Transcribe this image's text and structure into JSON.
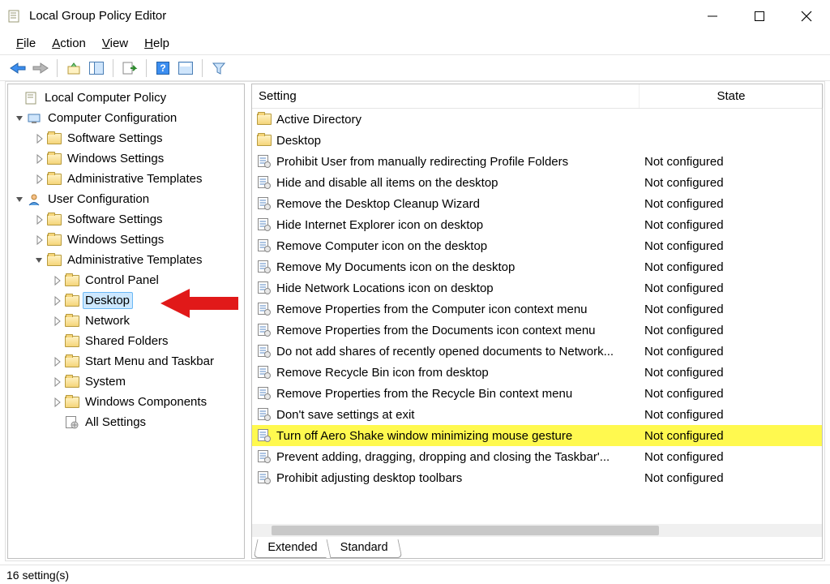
{
  "window": {
    "title": "Local Group Policy Editor"
  },
  "menus": {
    "file": "File",
    "action": "Action",
    "view": "View",
    "help": "Help"
  },
  "tree": {
    "root": "Local Computer Policy",
    "cc": "Computer Configuration",
    "cc_ss": "Software Settings",
    "cc_ws": "Windows Settings",
    "cc_at": "Administrative Templates",
    "uc": "User Configuration",
    "uc_ss": "Software Settings",
    "uc_ws": "Windows Settings",
    "uc_at": "Administrative Templates",
    "uc_at_cp": "Control Panel",
    "uc_at_desktop": "Desktop",
    "uc_at_network": "Network",
    "uc_at_sf": "Shared Folders",
    "uc_at_smt": "Start Menu and Taskbar",
    "uc_at_sys": "System",
    "uc_at_wc": "Windows Components",
    "uc_at_all": "All Settings"
  },
  "list": {
    "col_setting": "Setting",
    "col_state": "State",
    "rows": [
      {
        "type": "folder",
        "name": "Active Directory",
        "state": ""
      },
      {
        "type": "folder",
        "name": "Desktop",
        "state": ""
      },
      {
        "type": "setting",
        "name": "Prohibit User from manually redirecting Profile Folders",
        "state": "Not configured"
      },
      {
        "type": "setting",
        "name": "Hide and disable all items on the desktop",
        "state": "Not configured"
      },
      {
        "type": "setting",
        "name": "Remove the Desktop Cleanup Wizard",
        "state": "Not configured"
      },
      {
        "type": "setting",
        "name": "Hide Internet Explorer icon on desktop",
        "state": "Not configured"
      },
      {
        "type": "setting",
        "name": "Remove Computer icon on the desktop",
        "state": "Not configured"
      },
      {
        "type": "setting",
        "name": "Remove My Documents icon on the desktop",
        "state": "Not configured"
      },
      {
        "type": "setting",
        "name": "Hide Network Locations icon on desktop",
        "state": "Not configured"
      },
      {
        "type": "setting",
        "name": "Remove Properties from the Computer icon context menu",
        "state": "Not configured"
      },
      {
        "type": "setting",
        "name": "Remove Properties from the Documents icon context menu",
        "state": "Not configured"
      },
      {
        "type": "setting",
        "name": "Do not add shares of recently opened documents to Network...",
        "state": "Not configured"
      },
      {
        "type": "setting",
        "name": "Remove Recycle Bin icon from desktop",
        "state": "Not configured"
      },
      {
        "type": "setting",
        "name": "Remove Properties from the Recycle Bin context menu",
        "state": "Not configured"
      },
      {
        "type": "setting",
        "name": "Don't save settings at exit",
        "state": "Not configured"
      },
      {
        "type": "setting",
        "name": "Turn off Aero Shake window minimizing mouse gesture",
        "state": "Not configured",
        "highlight": true
      },
      {
        "type": "setting",
        "name": "Prevent adding, dragging, dropping and closing the Taskbar'...",
        "state": "Not configured"
      },
      {
        "type": "setting",
        "name": "Prohibit adjusting desktop toolbars",
        "state": "Not configured"
      }
    ]
  },
  "tabs": {
    "extended": "Extended",
    "standard": "Standard"
  },
  "status": {
    "text": "16 setting(s)"
  }
}
